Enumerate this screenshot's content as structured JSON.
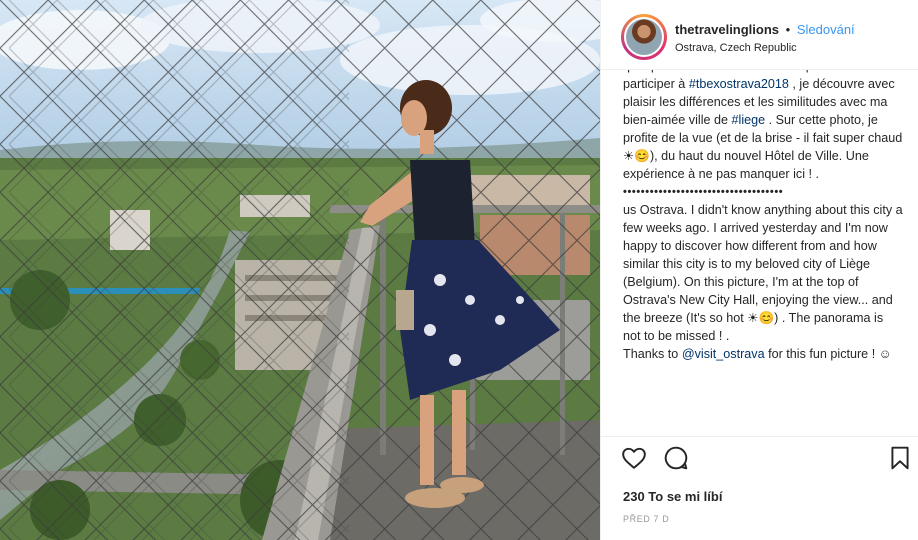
{
  "post": {
    "photo_alt": "Woman standing on the observation deck of Ostrava New City Hall, looking over the city",
    "author": {
      "username": "thetravelinglions",
      "separator": "•",
      "follow_label": "Sledování",
      "location": "Ostrava, Czech Republic"
    },
    "caption": {
      "line_top": "quelques semaines. Arrivée hier pour",
      "fr_1": "participer à ",
      "fr_hashtag1": "#tbexostrava2018",
      "fr_2": " , je découvre avec plaisir les différences et les similitudes avec ma bien-aimée ville de ",
      "fr_hashtag2": "#liege",
      "fr_3": " . Sur cette photo, je profite de la vue (et de la brise - il fait super chaud ☀😊), du haut du nouvel Hôtel de Ville. Une expérience à ne pas manquer ici ! .",
      "divider": "••••••••••••••••••••••••••••••••••••",
      "en_1": "us Ostrava. I didn't know anything about this city a few weeks ago. I arrived yesterday and I'm now happy to discover how different from and how similar this city is to my beloved city of Liège (Belgium). On this picture, I'm at the top of Ostrava's New City Hall, enjoying the view... and the breeze (It's so hot ☀😊) . The panorama is not to be missed ! .",
      "en_2": "Thanks to ",
      "en_mention": "@visit_ostrava",
      "en_3": " for this fun picture ! ☺"
    },
    "actions": {
      "like_icon": "heart-icon",
      "comment_icon": "comment-icon",
      "save_icon": "bookmark-icon"
    },
    "likes_text": "230 To se mi líbí",
    "time_text": "PŘED 7 D"
  },
  "colors": {
    "link_blue": "#3897f0",
    "hashtag_blue": "#003569",
    "text": "#262626",
    "muted": "#999999",
    "border": "#efefef"
  }
}
